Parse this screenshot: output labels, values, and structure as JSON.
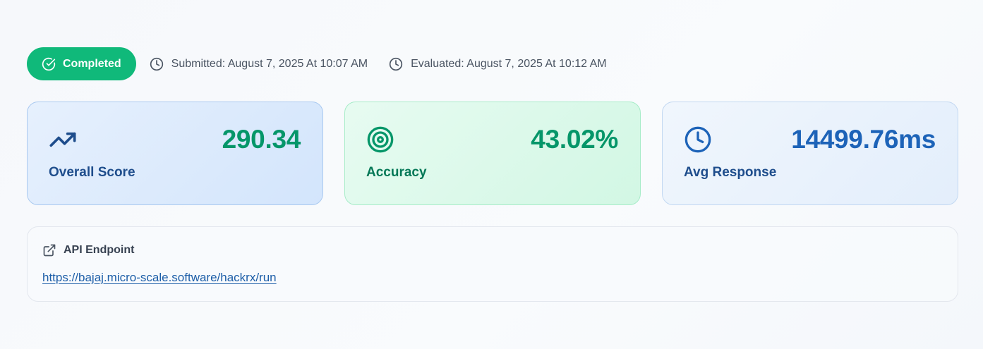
{
  "status": {
    "label": "Completed",
    "icon": "check-circle-icon",
    "color": "#10b97a"
  },
  "meta": {
    "submitted": "Submitted: August 7, 2025 At 10:07 AM",
    "evaluated": "Evaluated: August 7, 2025 At 10:12 AM",
    "icon": "clock-icon"
  },
  "cards": [
    {
      "label": "Overall Score",
      "value": "290.34",
      "icon": "trending-up-icon"
    },
    {
      "label": "Accuracy",
      "value": "43.02%",
      "icon": "target-icon"
    },
    {
      "label": "Avg Response",
      "value": "14499.76ms",
      "icon": "clock-icon"
    }
  ],
  "endpoint": {
    "title": "API Endpoint",
    "url": "https://bajaj.micro-scale.software/hackrx/run",
    "icon": "external-link-icon"
  },
  "colors": {
    "success": "#10b97a",
    "score_value": "#059669",
    "response_value": "#1d63b8",
    "link": "#1d5ea8"
  }
}
